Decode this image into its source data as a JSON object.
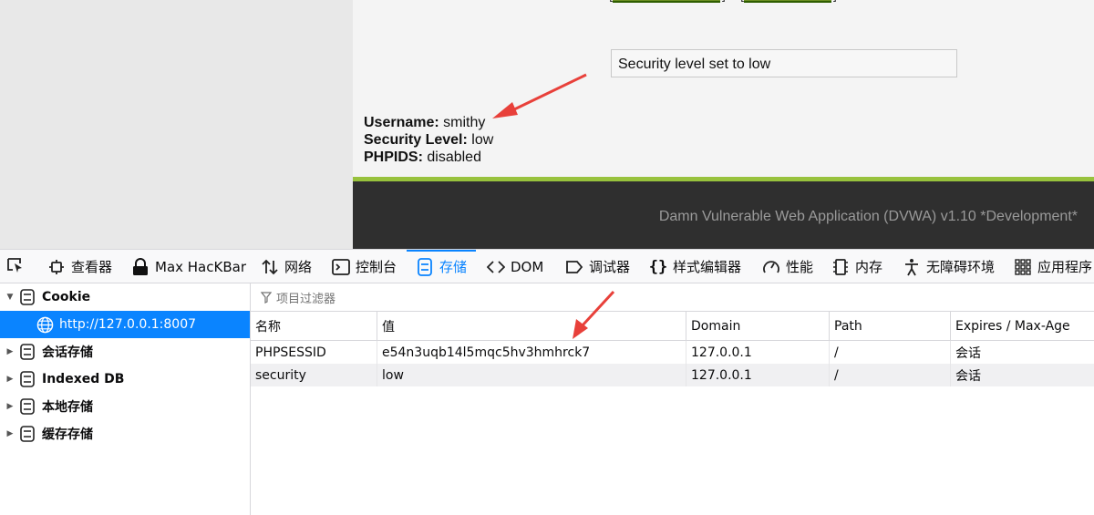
{
  "page": {
    "message": "Security level set to low",
    "user_info": [
      {
        "label": "Username:",
        "value": "smithy"
      },
      {
        "label": "Security Level:",
        "value": "low"
      },
      {
        "label": "PHPIDS:",
        "value": "disabled"
      }
    ],
    "footer": "Damn Vulnerable Web Application (DVWA) v1.10 *Development*",
    "colors": {
      "accent_bar": "#98c23d",
      "footer_bg": "#2f2f2f",
      "annotation_arrow": "#e8403a"
    }
  },
  "devtools": {
    "toolbar": [
      {
        "label": "查看器",
        "icon": "inspector-icon"
      },
      {
        "label": "Max HacKBar",
        "icon": "hackbar-icon"
      },
      {
        "label": "网络",
        "icon": "network-arrows-icon"
      },
      {
        "label": "控制台",
        "icon": "console-icon"
      },
      {
        "label": "存储",
        "icon": "storage-icon",
        "active": true
      },
      {
        "label": "DOM",
        "icon": "dom-icon"
      },
      {
        "label": "调试器",
        "icon": "debugger-icon"
      },
      {
        "label": "样式编辑器",
        "icon": "style-editor-icon"
      },
      {
        "label": "性能",
        "icon": "performance-icon"
      },
      {
        "label": "内存",
        "icon": "memory-icon"
      },
      {
        "label": "无障碍环境",
        "icon": "accessibility-icon"
      },
      {
        "label": "应用程序",
        "icon": "application-icon"
      }
    ],
    "sidebar": [
      {
        "label": "Cookie",
        "expanded": true
      },
      {
        "label": "http://127.0.0.1:8007",
        "selected": true
      },
      {
        "label": "会话存储"
      },
      {
        "label": "Indexed DB"
      },
      {
        "label": "本地存储"
      },
      {
        "label": "缓存存储"
      }
    ],
    "filter_placeholder": "项目过滤器",
    "table": {
      "columns": [
        "名称",
        "值",
        "Domain",
        "Path",
        "Expires / Max-Age"
      ],
      "rows": [
        [
          "PHPSESSID",
          "e54n3uqb14l5mqc5hv3hmhrck7",
          "127.0.0.1",
          "/",
          "会话"
        ],
        [
          "security",
          "low",
          "127.0.0.1",
          "/",
          "会话"
        ]
      ]
    }
  }
}
